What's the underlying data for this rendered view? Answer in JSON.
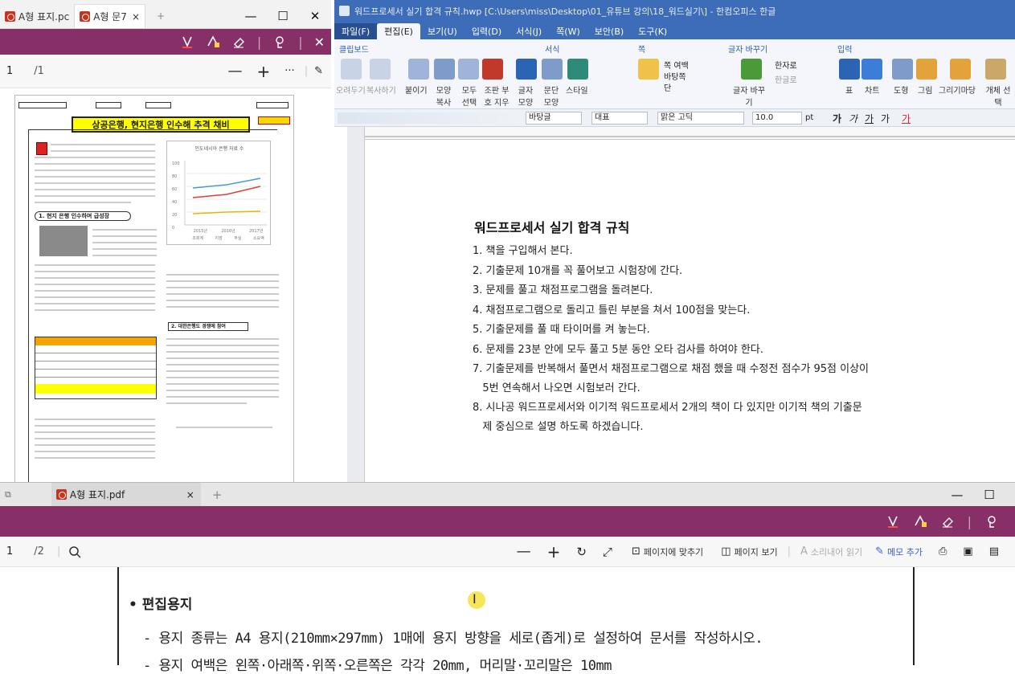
{
  "pdf_small": {
    "tabs": [
      {
        "label": "A형 표지.pc"
      },
      {
        "label": "A형 문7",
        "close": "×"
      },
      {
        "label": "+"
      }
    ],
    "window_controls": [
      "—",
      "☐",
      "✕"
    ],
    "toolbar": {
      "page_current": "1",
      "page_total": "/1",
      "minus": "—",
      "plus": "+",
      "more": "···"
    },
    "page": {
      "banner_title": "상공은행, 현지은행 인수해 추격 채비",
      "section1": "1. 현지 은행 인수하며 급성장",
      "section2": "2. 대한은행도 경쟁에 참여",
      "chart_caption": "인도네시아 은행 자료 수",
      "y_ticks": [
        "100",
        "80",
        "60",
        "40",
        "20",
        "0"
      ],
      "x_ticks": [
        "2015년",
        "2016년",
        "2017년"
      ],
      "legend": [
        "조회계",
        "지점",
        "부실",
        "소요액"
      ]
    }
  },
  "hwp": {
    "title": "워드프로세서 실기 합격 규칙.hwp [C:\\Users\\miss\\Desktop\\01_유튜브 강의\\18_워드실기\\] - 한컴오피스 한글",
    "menus": [
      "파일(F)",
      "편집(E)",
      "보기(U)",
      "입력(D)",
      "서식(J)",
      "쪽(W)",
      "보안(B)",
      "도구(K)"
    ],
    "groups": [
      "클립보드",
      "서식",
      "쪽",
      "글자 바꾸기",
      "입력"
    ],
    "ribbon_labels": [
      "오려두기",
      "복사하기",
      "붙이기",
      "모양 복사",
      "모두 선택",
      "조판 부호 지우기",
      "글자 모양",
      "문단 모양",
      "스타일",
      "쪽 여백",
      "바탕쪽",
      "단",
      "글자 바꾸기",
      "한자로",
      "한글로",
      "표",
      "차트",
      "도형",
      "그림",
      "그리기마당",
      "개체 선택"
    ],
    "format": {
      "style": "바탕글",
      "lang": "대표",
      "font": "맑은 고딕",
      "size": "10.0",
      "unit": "pt",
      "chars": [
        "가",
        "가",
        "가",
        "가",
        "가"
      ]
    },
    "doc": {
      "title": "워드프로세서 실기 합격 규칙",
      "rules": [
        "1. 책을 구입해서 본다.",
        "2. 기출문제 10개를 꼭 풀어보고 시험장에 간다.",
        "3. 문제를 풀고 채점프로그램을 돌려본다.",
        "4. 채점프로그램으로 돌리고 틀린 부분을 쳐서 100점을 맞는다.",
        "5. 기출문제를 풀 때 타이머를 켜 놓는다.",
        "6. 문제를 23분 안에 모두 풀고 5분 동안 오타 검사를 하여야 한다.",
        "7. 기출문제를 반복해서 풀면서 채점프로그램으로 채점 했을 때 수정전 점수가 95점 이상이",
        "   5번 연속해서 나오면 시험보러 간다.",
        "8. 시나공 워드프로세서와 이기적 워드프로세서 2개의 책이 다 있지만 이기적 책의 기출문",
        "   제 중심으로 설명 하도록 하겠습니다."
      ]
    }
  },
  "pdf_large": {
    "tab": "A형 표지.pdf",
    "tab_close": "×",
    "tab_new": "+",
    "window_controls": [
      "—",
      "☐"
    ],
    "toolbar": {
      "page_current": "1",
      "page_total": "/2",
      "fit": "페이지에 맞추기",
      "view": "페이지 보기",
      "read": "소리내어 읽기",
      "note": "메모 추가"
    },
    "content": {
      "heading": "• 편집용지",
      "line1": "-  용지 종류는 A4 용지(210mm×297mm) 1매에 용지 방향을 세로(좁게)로 설정하여 문서를 작성하시오.",
      "line2": "-  용지 여백은 왼쪽·아래쪽·위쪽·오른쪽은 각각 20mm, 머리말·꼬리말은 10mm"
    }
  },
  "colors": {
    "accent_purple": "#873068",
    "hwp_blue": "#3d6cb8",
    "banner_yellow": "#ffff00"
  }
}
